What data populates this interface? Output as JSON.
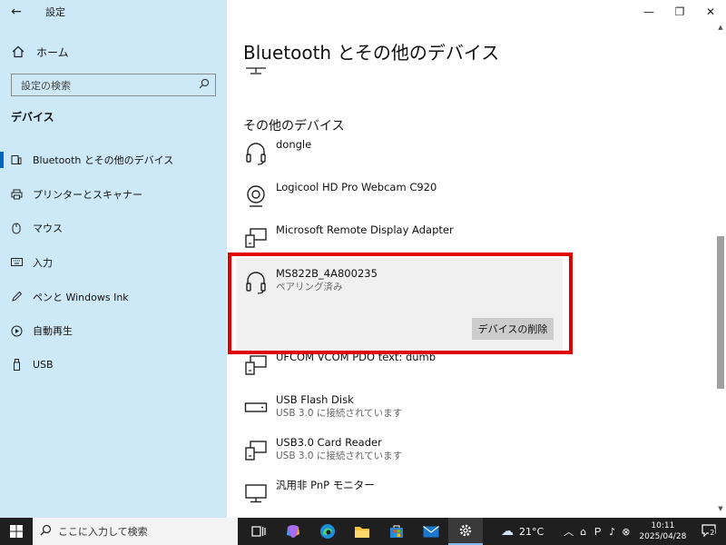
{
  "window": {
    "app_title": "設定",
    "controls": {
      "minimize": "—",
      "maximize": "❐",
      "close": "✕"
    }
  },
  "sidebar": {
    "back_glyph": "←",
    "home_label": "ホーム",
    "search_placeholder": "設定の検索",
    "section_header": "デバイス",
    "items": [
      {
        "label": "Bluetooth とその他のデバイス",
        "icon": "bluetooth-devices-icon",
        "active": true
      },
      {
        "label": "プリンターとスキャナー",
        "icon": "printer-icon"
      },
      {
        "label": "マウス",
        "icon": "mouse-icon"
      },
      {
        "label": "入力",
        "icon": "keyboard-icon"
      },
      {
        "label": "ペンと Windows Ink",
        "icon": "pen-icon"
      },
      {
        "label": "自動再生",
        "icon": "autoplay-icon"
      },
      {
        "label": "USB",
        "icon": "usb-icon"
      }
    ]
  },
  "main": {
    "title": "Bluetooth とその他のデバイス",
    "section_title": "その他のデバイス",
    "devices": [
      {
        "name": "dongle",
        "status": "",
        "icon": "headset-icon"
      },
      {
        "name": "Logicool HD Pro Webcam C920",
        "status": "",
        "icon": "webcam-icon"
      },
      {
        "name": "Microsoft Remote Display Adapter",
        "status": "",
        "icon": "display-adapter-icon"
      },
      {
        "name": "MS822B_4A800235",
        "status": "ペアリング済み",
        "icon": "headset-icon",
        "selected": true,
        "action_label": "デバイスの削除"
      },
      {
        "name": "UFCOM VCOM PDO text: dumb",
        "status": "",
        "icon": "generic-device-icon"
      },
      {
        "name": "USB Flash Disk",
        "status": "USB 3.0 に接続されています",
        "icon": "drive-icon"
      },
      {
        "name": "USB3.0 Card Reader",
        "status": "USB 3.0 に接続されています",
        "icon": "generic-device-icon"
      },
      {
        "name": "汎用非 PnP モニター",
        "status": "",
        "icon": "monitor-icon"
      }
    ]
  },
  "taskbar": {
    "search_placeholder": "ここに入力して検索",
    "weather": "21°C",
    "time": "10:11",
    "date": "2025/04/28",
    "notification_count": "2"
  },
  "colors": {
    "sidebar_bg": "#cde8f7",
    "accent": "#0067c0",
    "highlight": "#e00000",
    "taskbar_bg": "#1f1f1f"
  }
}
